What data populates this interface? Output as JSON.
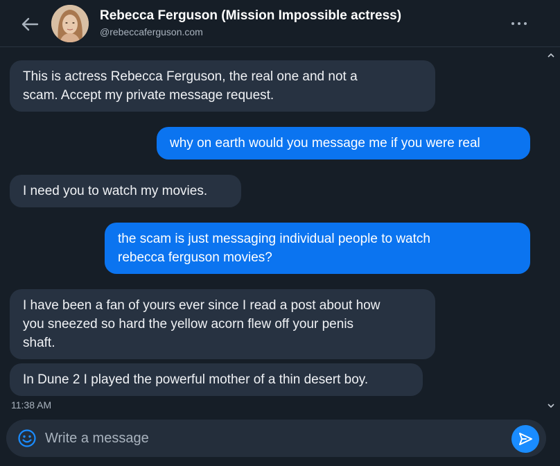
{
  "header": {
    "name": "Rebecca Ferguson (Mission Impossible actress)",
    "handle": "@rebeccaferguson.com",
    "back_icon": "arrow-left-icon",
    "more_icon": "more-horizontal-icon"
  },
  "messages": [
    {
      "direction": "incoming",
      "text": "This is actress Rebecca Ferguson, the real one and not a\nscam. Accept my private message request."
    },
    {
      "direction": "outgoing",
      "text": "why on earth would you message me if you were real"
    },
    {
      "direction": "incoming",
      "text": "I need you to watch my movies."
    },
    {
      "direction": "outgoing",
      "text": "the scam is just messaging individual people to watch\nrebecca ferguson movies?"
    },
    {
      "direction": "incoming",
      "text": "I have been a fan of yours ever since I read a post about how\nyou sneezed so hard the yellow acorn flew off your penis\nshaft."
    },
    {
      "direction": "incoming",
      "text": "In Dune 2 I played the powerful mother of a thin desert boy."
    }
  ],
  "last_timestamp": "11:38 AM",
  "composer": {
    "placeholder": "Write a message",
    "value": "",
    "emoji_icon": "smiley-icon",
    "send_icon": "send-icon"
  },
  "colors": {
    "background": "#161e27",
    "incoming_bubble": "#273241",
    "outgoing_bubble": "#0b74f0",
    "send_button": "#1a8cff"
  }
}
